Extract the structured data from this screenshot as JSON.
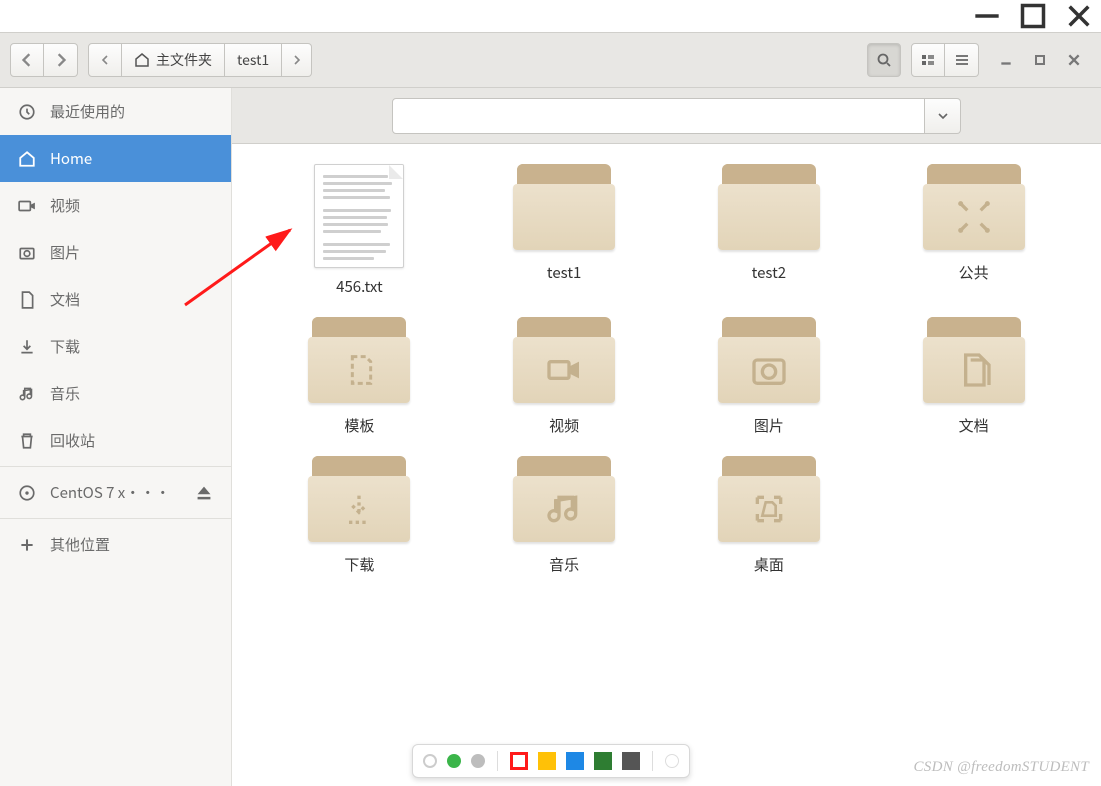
{
  "path": {
    "home_label": "主文件夹",
    "crumb2": "test1"
  },
  "sidebar": {
    "recent": "最近使用的",
    "home": "Home",
    "videos": "视频",
    "pictures": "图片",
    "documents": "文档",
    "downloads": "下载",
    "music": "音乐",
    "trash": "回收站",
    "disk": "CentOS 7 x···",
    "other": "其他位置"
  },
  "search": {
    "placeholder": ""
  },
  "files": {
    "f1": "456.txt",
    "f2": "test1",
    "f3": "test2",
    "f4": "公共",
    "f5": "模板",
    "f6": "视频",
    "f7": "图片",
    "f8": "文档",
    "f9": "下载",
    "f10": "音乐",
    "f11": "桌面"
  },
  "watermark": "CSDN @freedomSTUDENT"
}
